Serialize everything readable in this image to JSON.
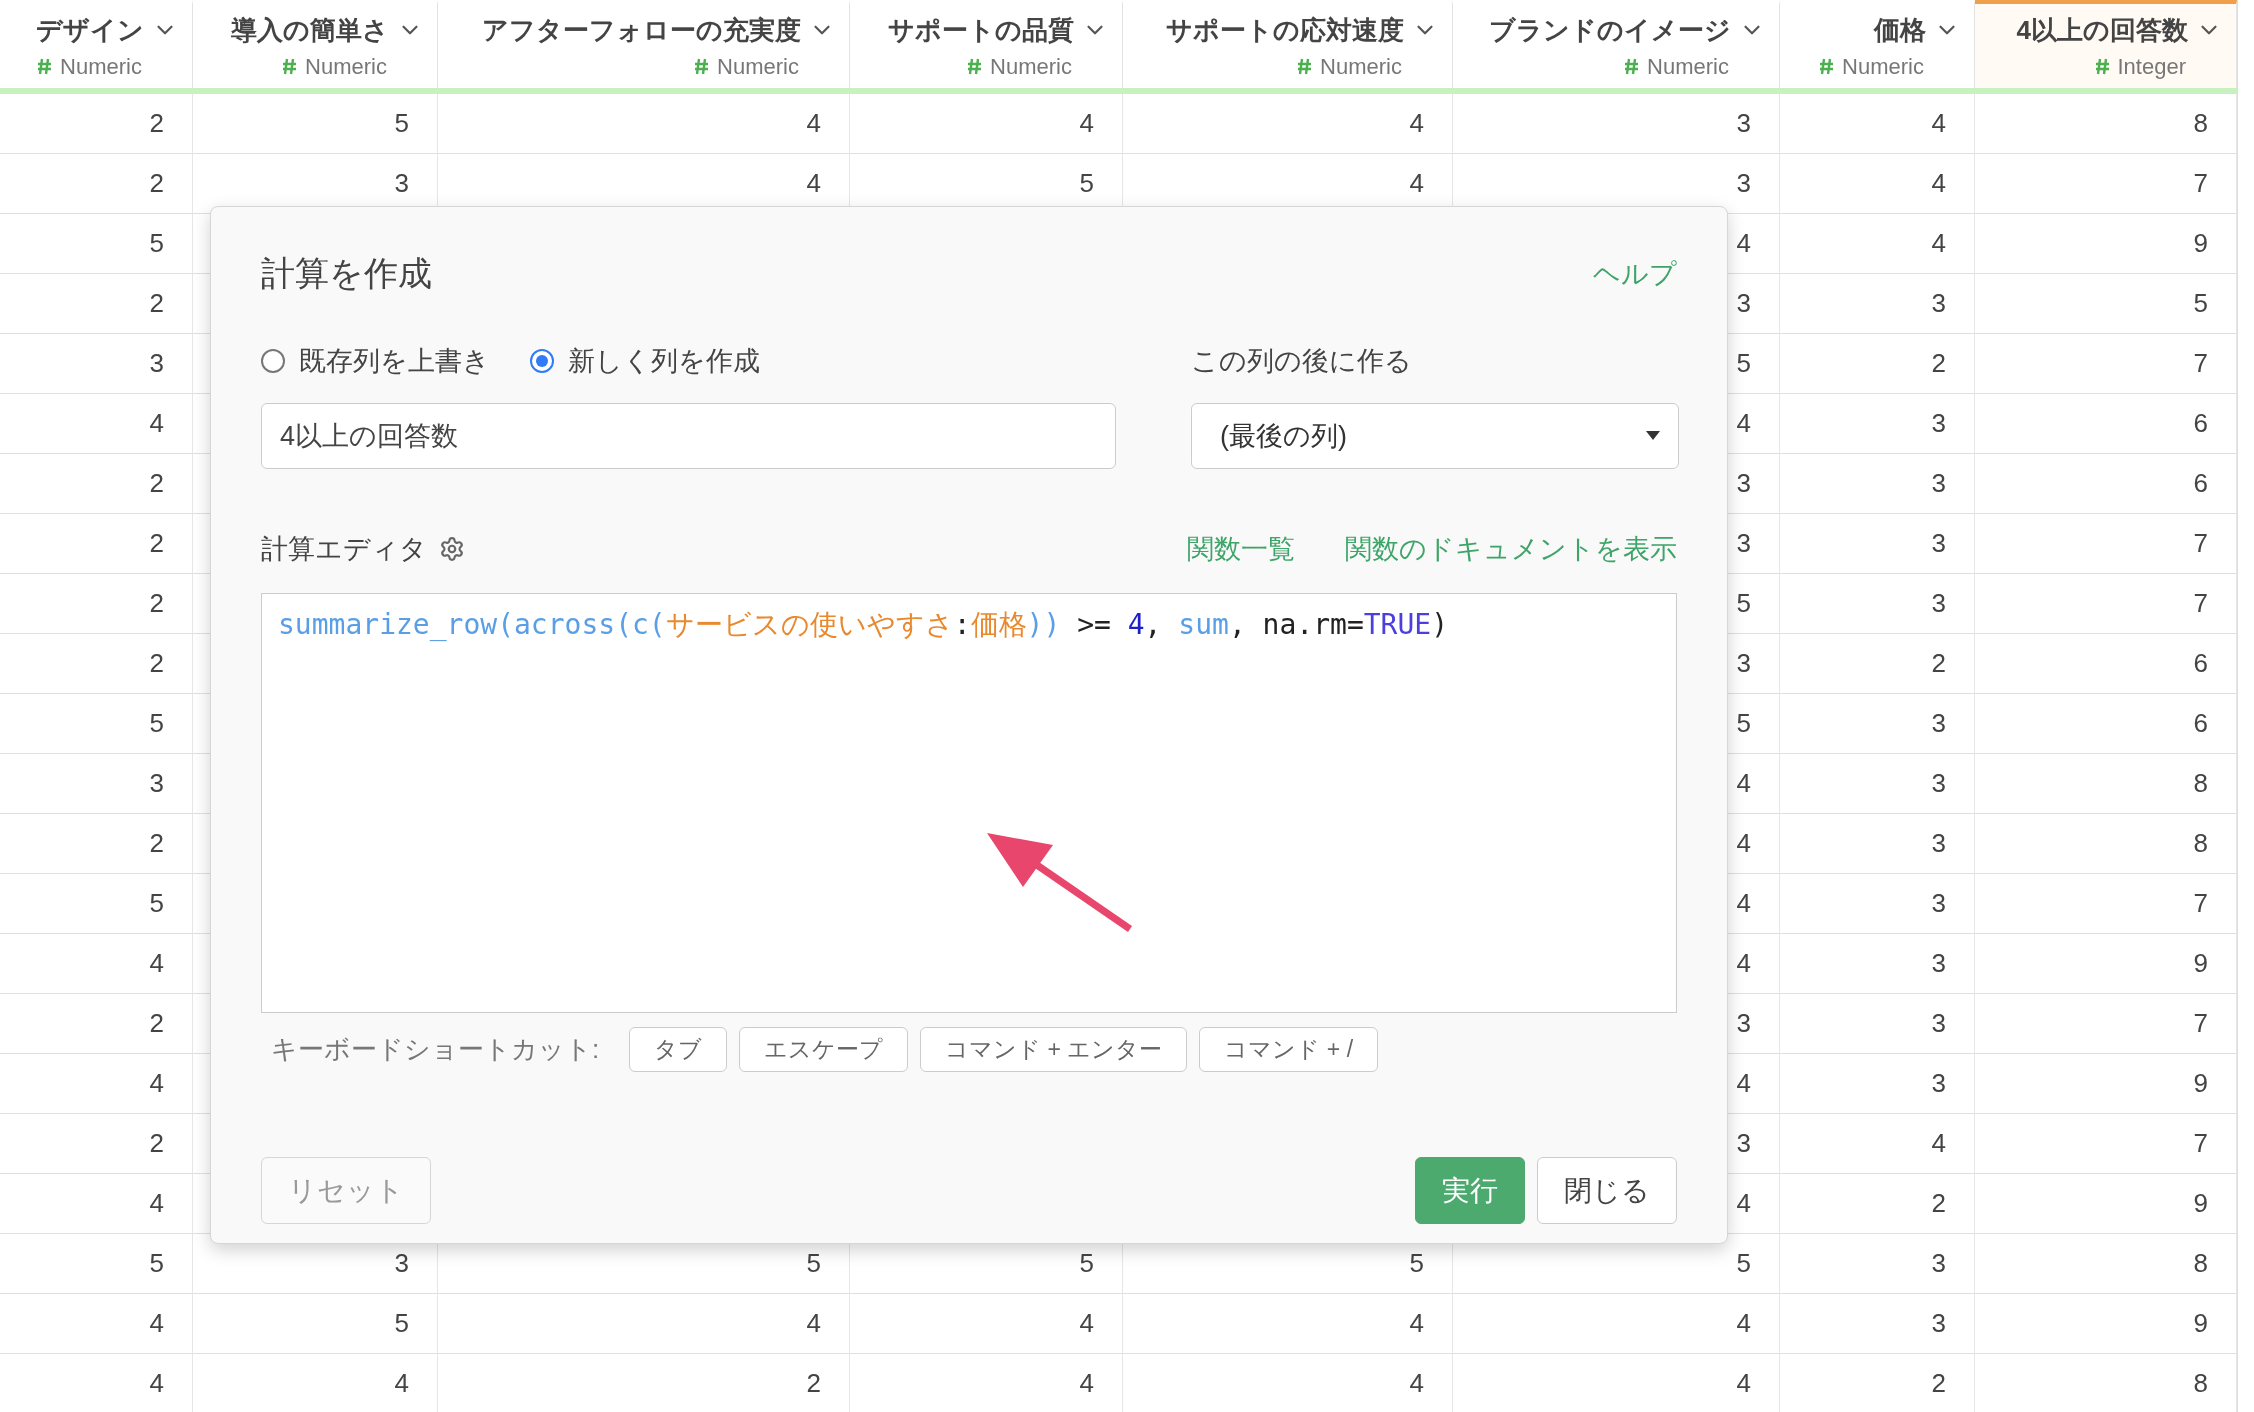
{
  "table": {
    "columns": [
      {
        "name": "デザイン",
        "type": "Numeric",
        "selected": false
      },
      {
        "name": "導入の簡単さ",
        "type": "Numeric",
        "selected": false
      },
      {
        "name": "アフターフォローの充実度",
        "type": "Numeric",
        "selected": false
      },
      {
        "name": "サポートの品質",
        "type": "Numeric",
        "selected": false
      },
      {
        "name": "サポートの応対速度",
        "type": "Numeric",
        "selected": false
      },
      {
        "name": "ブランドのイメージ",
        "type": "Numeric",
        "selected": false
      },
      {
        "name": "価格",
        "type": "Numeric",
        "selected": false
      },
      {
        "name": "4以上の回答数",
        "type": "Integer",
        "selected": true
      }
    ],
    "rows": [
      [
        "2",
        "5",
        "4",
        "4",
        "4",
        "3",
        "4",
        "8"
      ],
      [
        "2",
        "3",
        "4",
        "5",
        "4",
        "3",
        "4",
        "7"
      ],
      [
        "5",
        null,
        null,
        null,
        null,
        "4",
        "4",
        "9"
      ],
      [
        "2",
        null,
        null,
        null,
        null,
        "3",
        "3",
        "5"
      ],
      [
        "3",
        null,
        null,
        null,
        null,
        "5",
        "2",
        "7"
      ],
      [
        "4",
        null,
        null,
        null,
        null,
        "4",
        "3",
        "6"
      ],
      [
        "2",
        null,
        null,
        null,
        null,
        "3",
        "3",
        "6"
      ],
      [
        "2",
        null,
        null,
        null,
        null,
        "3",
        "3",
        "7"
      ],
      [
        "2",
        null,
        null,
        null,
        null,
        "5",
        "3",
        "7"
      ],
      [
        "2",
        null,
        null,
        null,
        null,
        "3",
        "2",
        "6"
      ],
      [
        "5",
        null,
        null,
        null,
        null,
        "5",
        "3",
        "6"
      ],
      [
        "3",
        null,
        null,
        null,
        null,
        "4",
        "3",
        "8"
      ],
      [
        "2",
        null,
        null,
        null,
        null,
        "4",
        "3",
        "8"
      ],
      [
        "5",
        null,
        null,
        null,
        null,
        "4",
        "3",
        "7"
      ],
      [
        "4",
        null,
        null,
        null,
        null,
        "4",
        "3",
        "9"
      ],
      [
        "2",
        null,
        null,
        null,
        null,
        "3",
        "3",
        "7"
      ],
      [
        "4",
        null,
        null,
        null,
        null,
        "4",
        "3",
        "9"
      ],
      [
        "2",
        null,
        null,
        null,
        null,
        "3",
        "4",
        "7"
      ],
      [
        "4",
        null,
        null,
        null,
        null,
        "4",
        "2",
        "9"
      ],
      [
        "5",
        "3",
        "5",
        "5",
        "5",
        "5",
        "3",
        "8"
      ],
      [
        "4",
        "5",
        "4",
        "4",
        "4",
        "4",
        "3",
        "9"
      ],
      [
        "4",
        "4",
        "2",
        "4",
        "4",
        "4",
        "2",
        "8"
      ]
    ]
  },
  "dialog": {
    "title": "計算を作成",
    "help_link": "ヘルプ",
    "mode_options": [
      {
        "label": "既存列を上書き",
        "selected": false
      },
      {
        "label": "新しく列を作成",
        "selected": true
      }
    ],
    "column_name": {
      "value": "4以上の回答数"
    },
    "position": {
      "label": "この列の後に作る",
      "value": "(最後の列)"
    },
    "editor": {
      "label": "計算エディタ",
      "links": [
        "関数一覧",
        "関数のドキュメントを表示"
      ],
      "tokens": [
        {
          "text": "summarize_row(across(c(",
          "kind": "function"
        },
        {
          "text": "サービスの使いやすさ",
          "kind": "column"
        },
        {
          "text": ":",
          "kind": "plain"
        },
        {
          "text": "価格",
          "kind": "column"
        },
        {
          "text": "))",
          "kind": "function"
        },
        {
          "text": " >= ",
          "kind": "plain"
        },
        {
          "text": "4",
          "kind": "number"
        },
        {
          "text": ", ",
          "kind": "plain"
        },
        {
          "text": "sum",
          "kind": "function"
        },
        {
          "text": ", na.rm=",
          "kind": "plain"
        },
        {
          "text": "TRUE",
          "kind": "constant"
        },
        {
          "text": ")",
          "kind": "plain"
        }
      ]
    },
    "shortcuts": {
      "label": "キーボードショートカット:",
      "keys": [
        "タブ",
        "エスケープ",
        "コマンド + エンター",
        "コマンド + /"
      ]
    },
    "buttons": [
      {
        "label": "リセット",
        "kind": "reset"
      },
      {
        "label": "実行",
        "kind": "primary"
      },
      {
        "label": "閉じる",
        "kind": "default"
      }
    ]
  }
}
